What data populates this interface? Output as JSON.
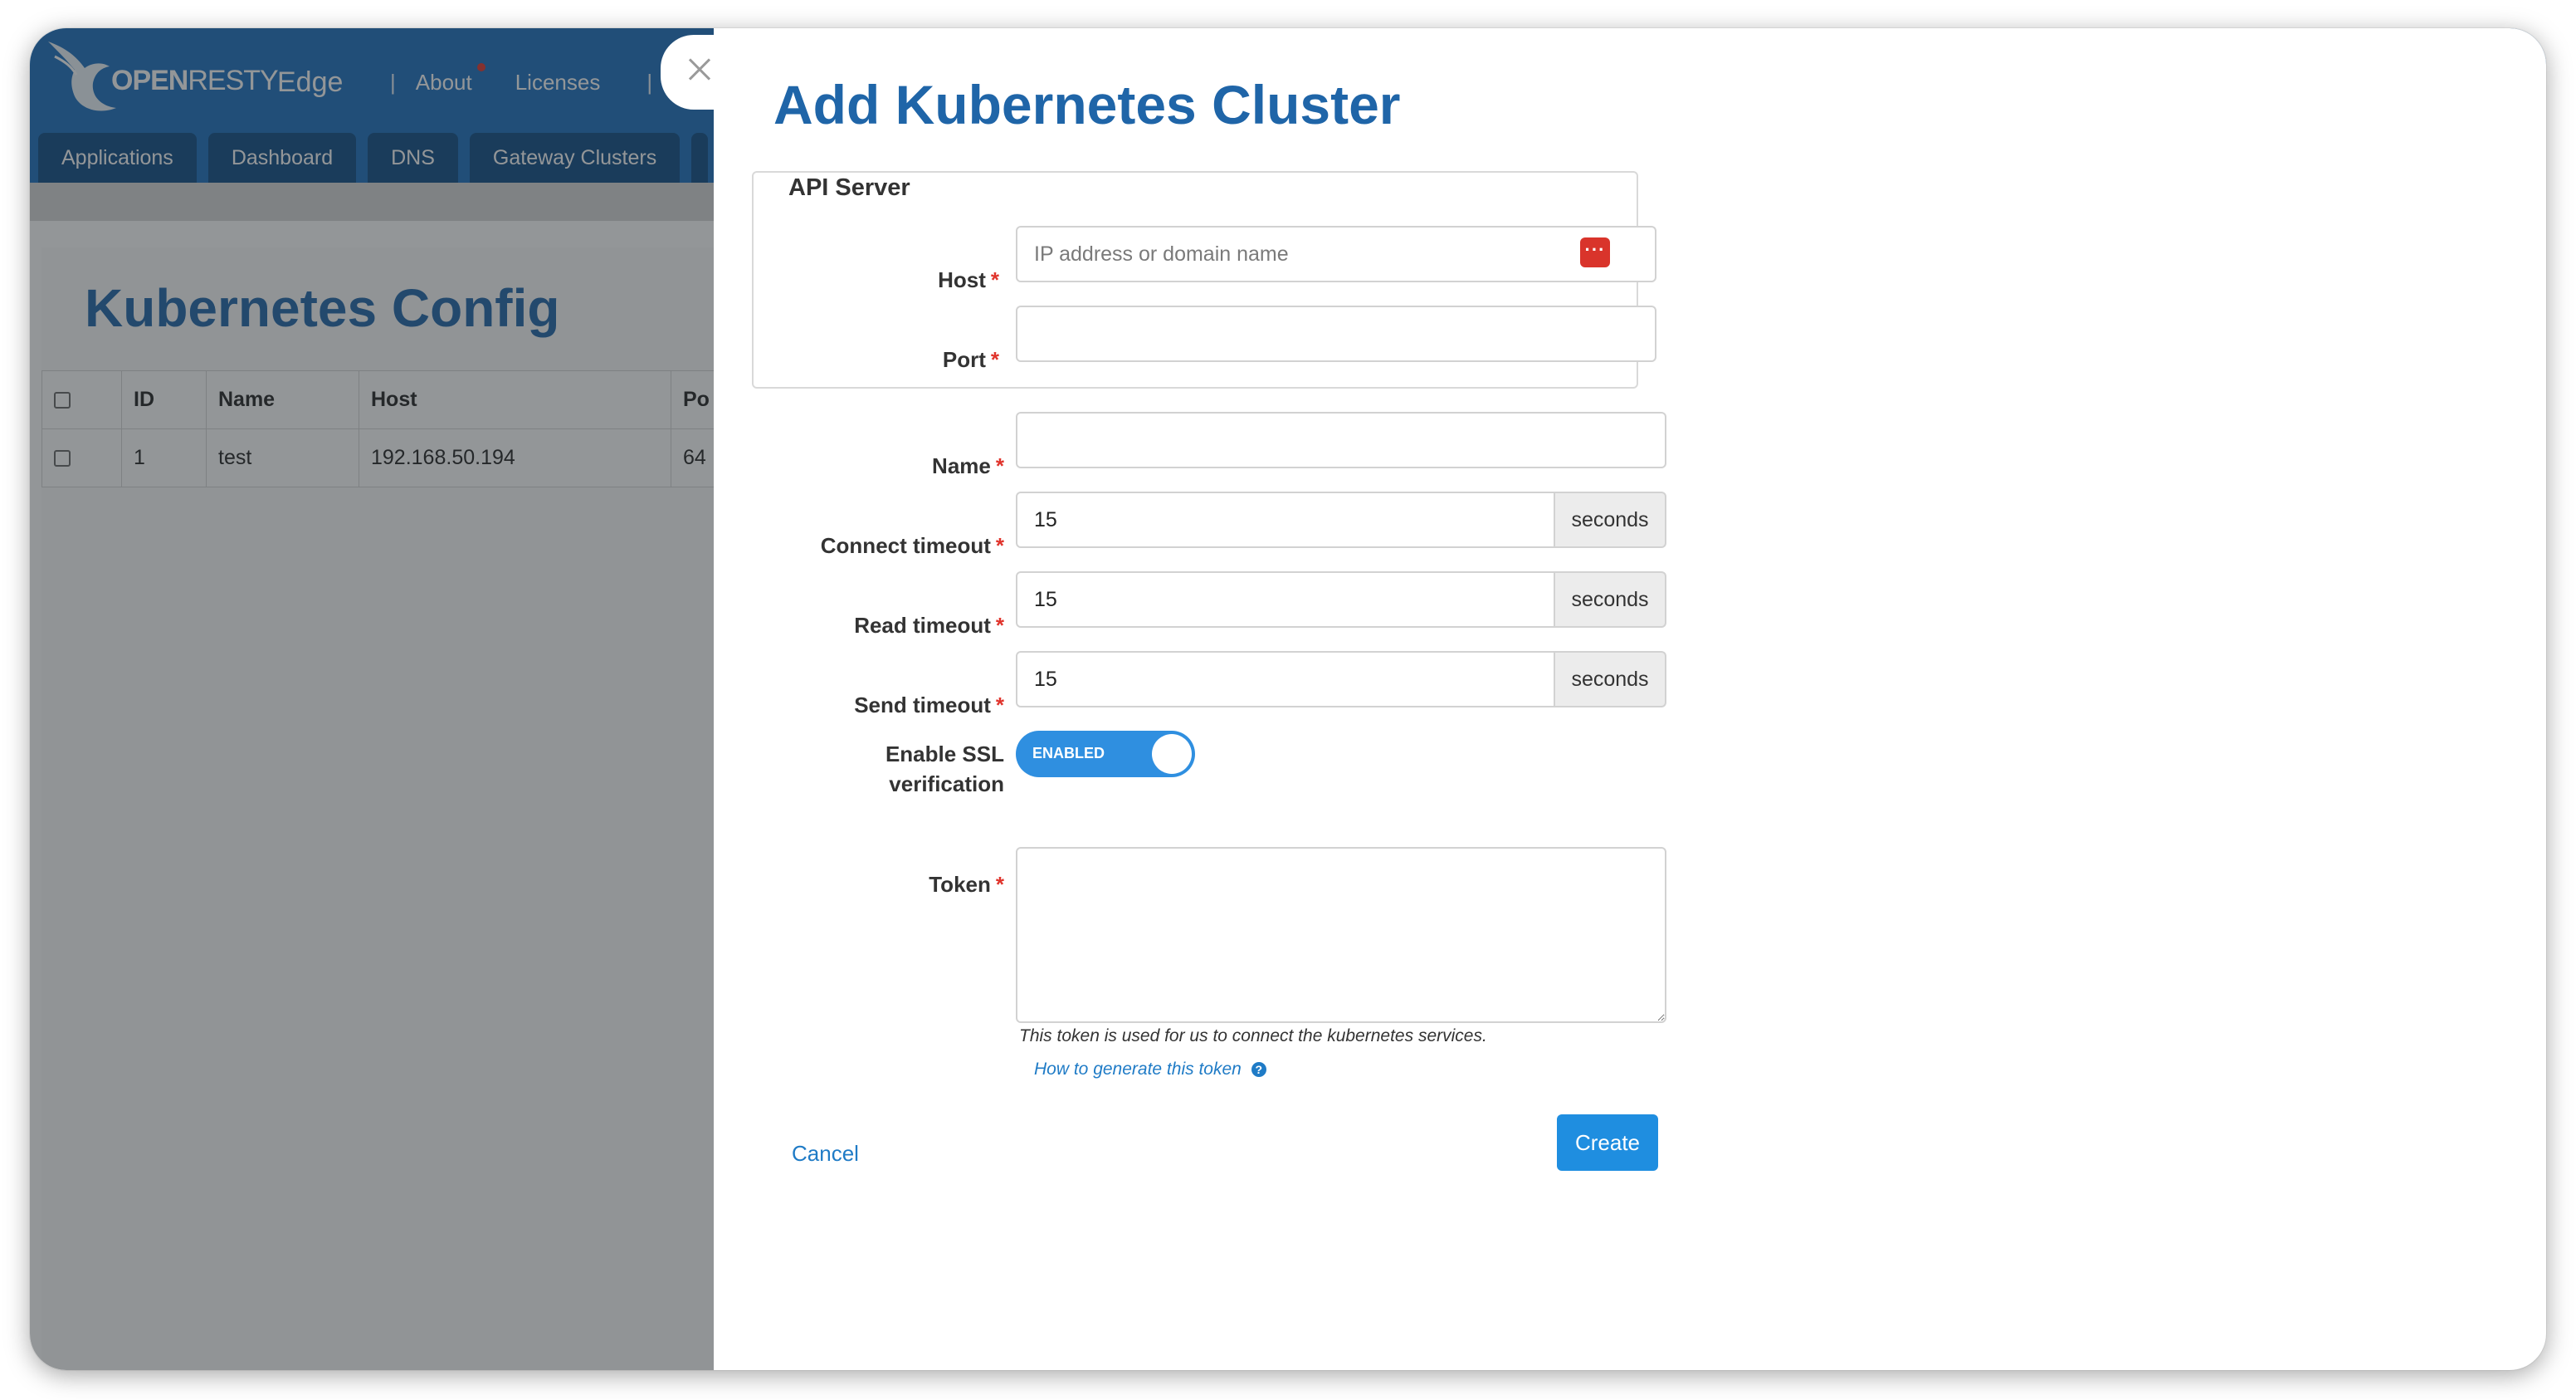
{
  "header": {
    "logo_main": "OPEN",
    "logo_rest": "RESTY",
    "logo_edge": "Edge",
    "nav": [
      "About",
      "Licenses"
    ],
    "separator": "|"
  },
  "tabs": [
    "Applications",
    "Dashboard",
    "DNS",
    "Gateway Clusters"
  ],
  "page": {
    "title": "Kubernetes Config",
    "table": {
      "columns": [
        "ID",
        "Name",
        "Host",
        "Po"
      ],
      "rows": [
        {
          "id": "1",
          "name": "test",
          "host": "192.168.50.194",
          "port": "64"
        }
      ]
    }
  },
  "modal": {
    "title": "Add Kubernetes Cluster",
    "api_server_legend": "API Server",
    "host": {
      "label": "Host",
      "placeholder": "IP address or domain name",
      "value": ""
    },
    "port": {
      "label": "Port",
      "value": ""
    },
    "name": {
      "label": "Name",
      "value": ""
    },
    "connect_timeout": {
      "label": "Connect timeout",
      "value": "15",
      "unit": "seconds"
    },
    "read_timeout": {
      "label": "Read timeout",
      "value": "15",
      "unit": "seconds"
    },
    "send_timeout": {
      "label": "Send timeout",
      "value": "15",
      "unit": "seconds"
    },
    "ssl": {
      "label_line1": "Enable SSL",
      "label_line2": "verification",
      "state": "ENABLED"
    },
    "token": {
      "label": "Token",
      "help": "This token is used for us to connect the kubernetes services.",
      "link": "How to generate this token"
    },
    "required_mark": "*",
    "cancel_label": "Cancel",
    "create_label": "Create"
  },
  "colors": {
    "accent": "#1f65a8",
    "header_bg": "#1a6fbf",
    "tab_bg": "#0d4a85",
    "primary_button": "#1f8ee0",
    "required": "#e0342c"
  },
  "icons": {
    "close": "close-icon",
    "password_manager": "password-manager-icon",
    "help": "question-circle-icon",
    "logo": "openresty-bird-logo"
  }
}
